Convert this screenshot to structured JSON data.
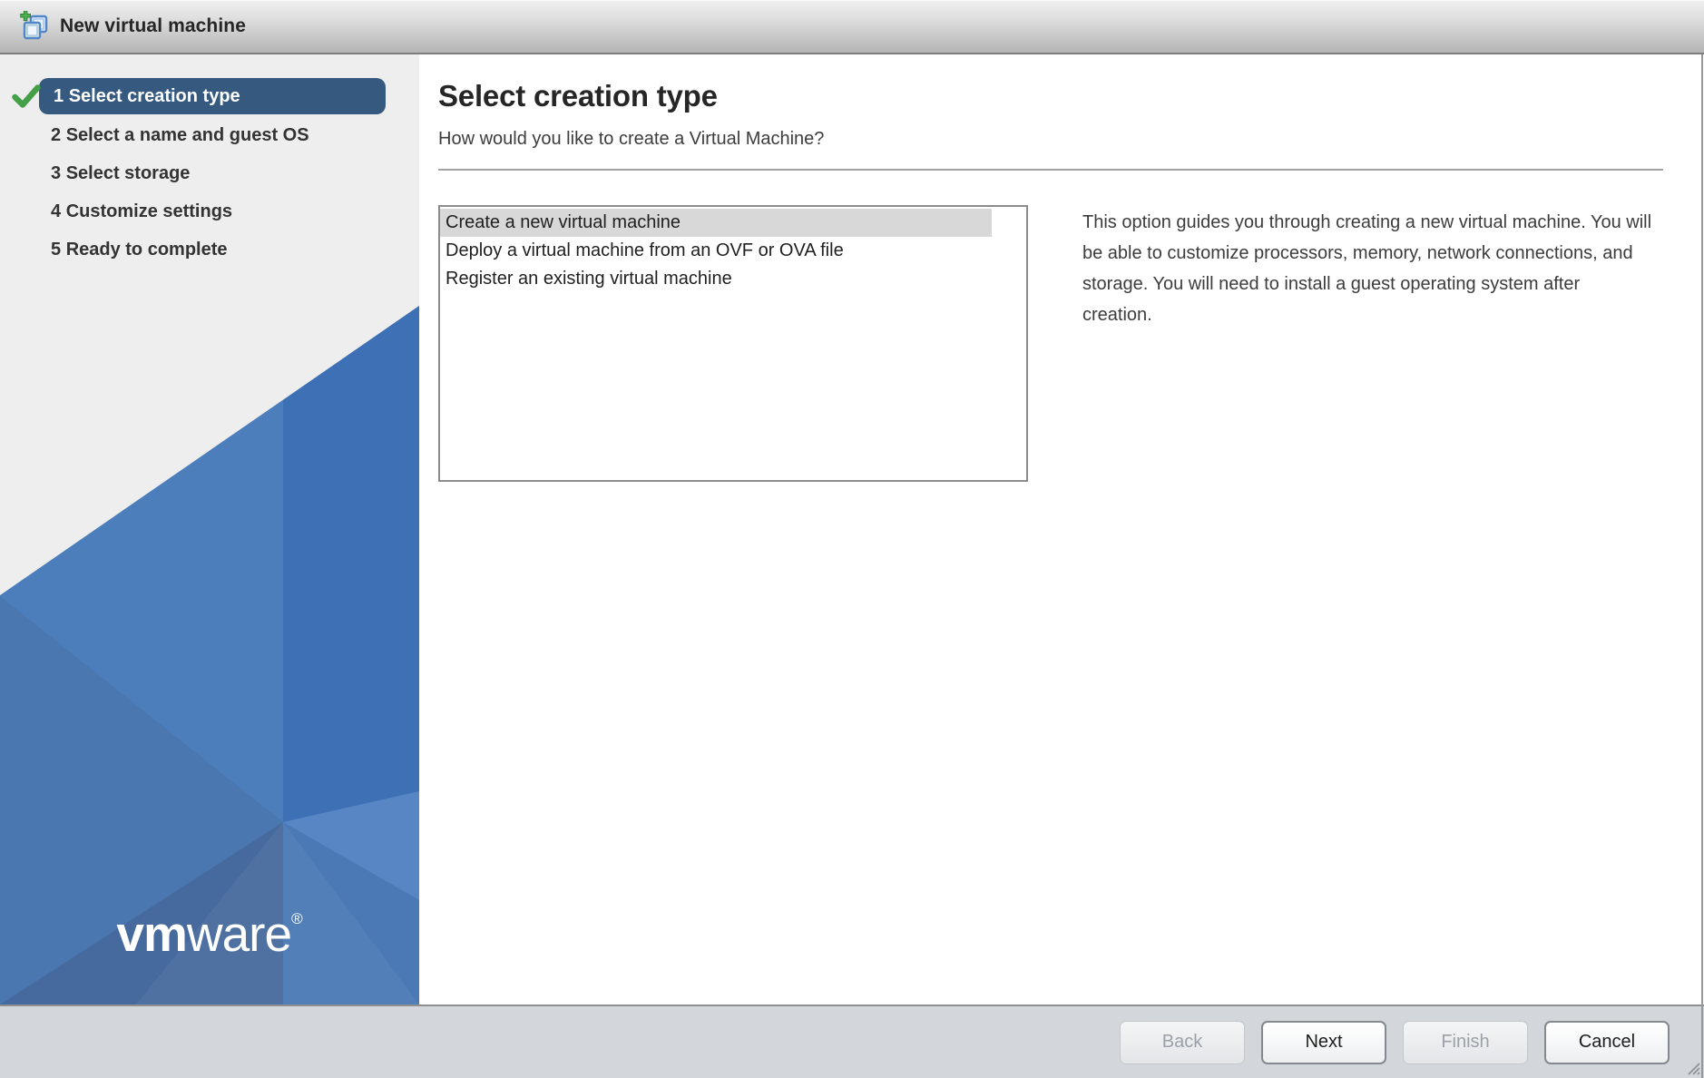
{
  "window": {
    "title": "New virtual machine"
  },
  "sidebar": {
    "steps": [
      {
        "number": "1",
        "label": "Select creation type",
        "active": true,
        "completed": true
      },
      {
        "number": "2",
        "label": "Select a name and guest OS",
        "active": false,
        "completed": false
      },
      {
        "number": "3",
        "label": "Select storage",
        "active": false,
        "completed": false
      },
      {
        "number": "4",
        "label": "Customize settings",
        "active": false,
        "completed": false
      },
      {
        "number": "5",
        "label": "Ready to complete",
        "active": false,
        "completed": false
      }
    ],
    "logo": {
      "bold": "vm",
      "light": "ware",
      "registered": "®"
    }
  },
  "main": {
    "heading": "Select creation type",
    "subheading": "How would you like to create a Virtual Machine?",
    "options": [
      {
        "label": "Create a new virtual machine",
        "selected": true
      },
      {
        "label": "Deploy a virtual machine from an OVF or OVA file",
        "selected": false
      },
      {
        "label": "Register an existing virtual machine",
        "selected": false
      }
    ],
    "description": "This option guides you through creating a new virtual machine. You will be able to customize processors, memory, network connections, and storage. You will need to install a guest operating system after creation."
  },
  "footer": {
    "buttons": [
      {
        "label": "Back",
        "enabled": false
      },
      {
        "label": "Next",
        "enabled": true
      },
      {
        "label": "Finish",
        "enabled": false
      },
      {
        "label": "Cancel",
        "enabled": true
      }
    ]
  },
  "colors": {
    "active_step_bg": "#35597f",
    "check_green": "#43a047",
    "selected_option_bg": "#d8d8d8",
    "blue_base": "#4c7ebc",
    "blue_dark_strip": "#3d70b4",
    "footer_bg": "#d3d6db"
  }
}
